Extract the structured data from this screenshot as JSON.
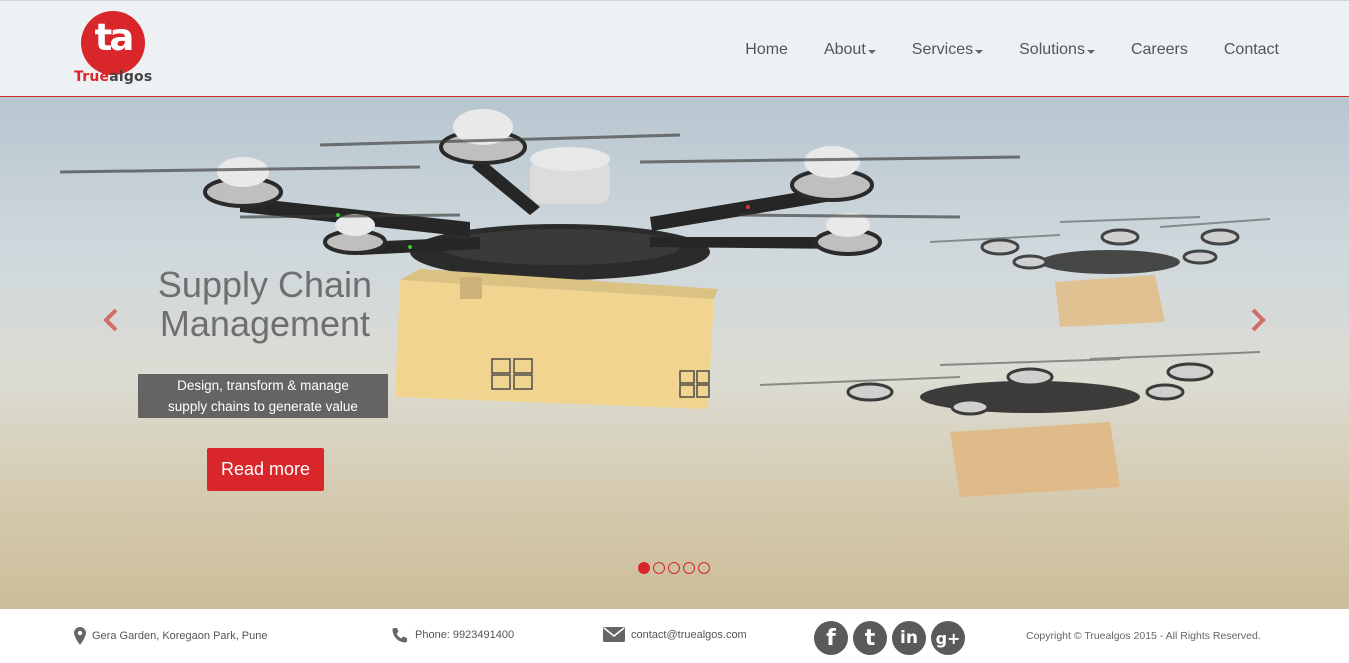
{
  "brand": {
    "logo_mark": "ta",
    "name_part1": "True",
    "name_part2": "algos"
  },
  "nav": {
    "items": [
      {
        "label": "Home",
        "dropdown": false
      },
      {
        "label": "About",
        "dropdown": true
      },
      {
        "label": "Services",
        "dropdown": true
      },
      {
        "label": "Solutions",
        "dropdown": true
      },
      {
        "label": "Careers",
        "dropdown": false
      },
      {
        "label": "Contact",
        "dropdown": false
      }
    ]
  },
  "hero": {
    "title_line1": "Supply Chain",
    "title_line2": "Management",
    "subtitle_line1": "Design, transform & manage",
    "subtitle_line2": "supply chains to generate value",
    "cta_label": "Read more",
    "prev_icon": "chevron-left-icon",
    "next_icon": "chevron-right-icon",
    "slide_count": 5,
    "active_slide": 1
  },
  "footer": {
    "address": "Gera Garden, Koregaon Park, Pune",
    "phone": "Phone: 9923491400",
    "email": "contact@truealgos.com",
    "social": [
      {
        "icon": "facebook-icon",
        "glyph": "f"
      },
      {
        "icon": "twitter-icon",
        "glyph": "t"
      },
      {
        "icon": "linkedin-icon",
        "glyph": "in"
      },
      {
        "icon": "google-plus-icon",
        "glyph": "g+"
      }
    ],
    "copyright": "Copyright © Truealgos 2015 - All Rights Reserved."
  },
  "colors": {
    "accent": "#d9262b",
    "header_bg": "#eef1f4",
    "caption_bg": "#5a5a5a"
  }
}
